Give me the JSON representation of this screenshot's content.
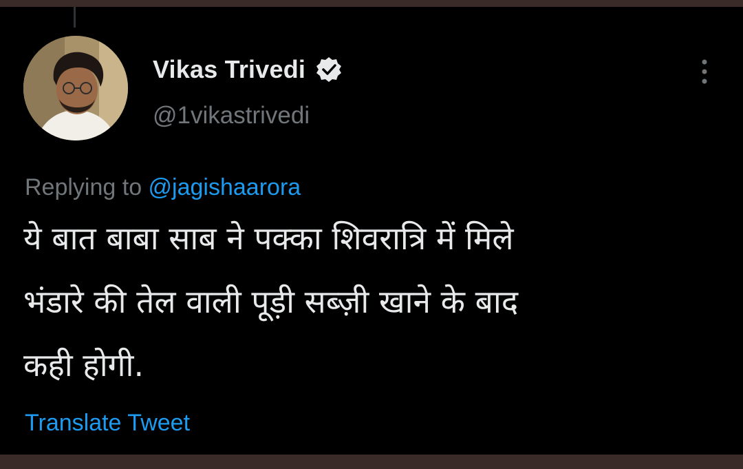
{
  "tweet": {
    "author": {
      "name": "Vikas Trivedi",
      "handle": "@1vikastrivedi",
      "verified": true
    },
    "reply": {
      "prefix": "Replying to ",
      "mention": "@jagishaarora"
    },
    "text_lines": [
      "ये बात बाबा साब ने पक्का शिवरात्रि में मिले",
      "भंडारे की तेल वाली पूड़ी सब्ज़ी खाने के बाद",
      "कही होगी."
    ],
    "translate_label": "Translate Tweet"
  },
  "icons": {
    "verified": "verified-badge-icon",
    "more": "more-vertical-icon"
  },
  "colors": {
    "background": "#000000",
    "text_primary": "#e7e9ea",
    "text_secondary": "#71767b",
    "accent": "#1d9bf0"
  }
}
